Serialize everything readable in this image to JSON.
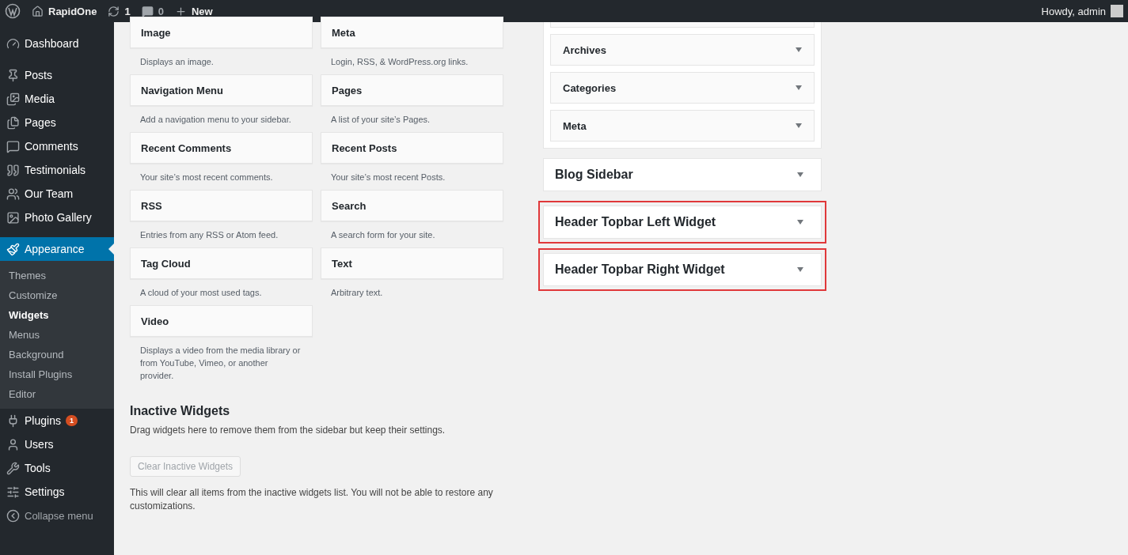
{
  "admin_bar": {
    "site_name": "RapidOne",
    "updates": "1",
    "comments": "0",
    "new_label": "New",
    "greeting": "Howdy, admin"
  },
  "menu": [
    {
      "label": "Dashboard",
      "selected": false
    },
    {
      "label": "Posts",
      "selected": false
    },
    {
      "label": "Media",
      "selected": false
    },
    {
      "label": "Pages",
      "selected": false
    },
    {
      "label": "Comments",
      "selected": false
    },
    {
      "label": "Testimonials",
      "selected": false
    },
    {
      "label": "Our Team",
      "selected": false
    },
    {
      "label": "Photo Gallery",
      "selected": false
    },
    {
      "label": "Appearance",
      "selected": true,
      "children": [
        {
          "label": "Themes",
          "selected": false
        },
        {
          "label": "Customize",
          "selected": false
        },
        {
          "label": "Widgets",
          "selected": true
        },
        {
          "label": "Menus",
          "selected": false
        },
        {
          "label": "Background",
          "selected": false
        },
        {
          "label": "Install Plugins",
          "selected": false
        },
        {
          "label": "Editor",
          "selected": false
        }
      ]
    },
    {
      "label": "Plugins",
      "selected": false,
      "badge": "1"
    },
    {
      "label": "Users",
      "selected": false
    },
    {
      "label": "Tools",
      "selected": false
    },
    {
      "label": "Settings",
      "selected": false
    },
    {
      "label": "Collapse menu",
      "selected": false
    }
  ],
  "available_widgets": [
    {
      "title": "Image",
      "description": "Displays an image."
    },
    {
      "title": "Meta",
      "description": "Login, RSS, & WordPress.org links."
    },
    {
      "title": "Navigation Menu",
      "description": "Add a navigation menu to your sidebar."
    },
    {
      "title": "Pages",
      "description": "A list of your site’s Pages."
    },
    {
      "title": "Recent Comments",
      "description": "Your site’s most recent comments."
    },
    {
      "title": "Recent Posts",
      "description": "Your site’s most recent Posts."
    },
    {
      "title": "RSS",
      "description": "Entries from any RSS or Atom feed."
    },
    {
      "title": "Search",
      "description": "A search form for your site."
    },
    {
      "title": "Tag Cloud",
      "description": "A cloud of your most used tags."
    },
    {
      "title": "Text",
      "description": "Arbitrary text."
    },
    {
      "title": "Video",
      "description": "Displays a video from the media library or from YouTube, Vimeo, or another provider."
    }
  ],
  "inactive": {
    "title": "Inactive Widgets",
    "description": "Drag widgets here to remove them from the sidebar but keep their settings.",
    "button": "Clear Inactive Widgets",
    "note": "This will clear all items from the inactive widgets list. You will not be able to restore any customizations."
  },
  "sidebar_widgets": [
    "Archives",
    "Categories",
    "Meta"
  ],
  "widget_areas": [
    {
      "title": "Blog Sidebar",
      "highlighted": false
    },
    {
      "title": "Header Topbar Left Widget",
      "highlighted": true
    },
    {
      "title": "Header Topbar Right Widget",
      "highlighted": true
    }
  ]
}
